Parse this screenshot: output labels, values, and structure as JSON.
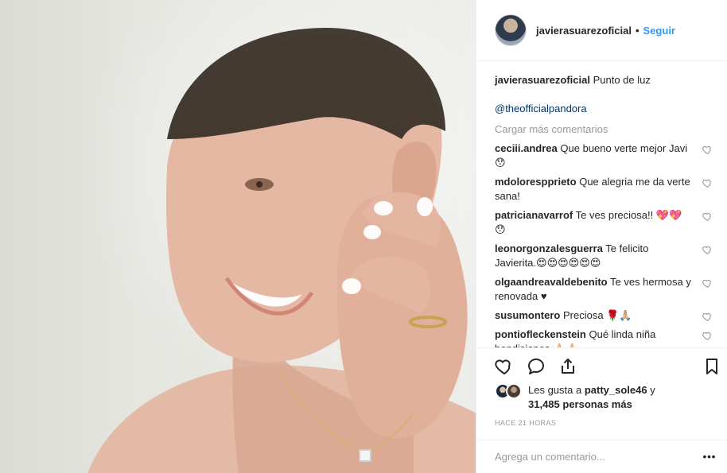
{
  "post": {
    "username": "javierasuarezoficial",
    "follow_label": "Seguir",
    "separator": "•"
  },
  "caption": {
    "username": "javierasuarezoficial",
    "text": "Punto de luz",
    "mention": "@theofficialpandora"
  },
  "load_more_label": "Cargar más comentarios",
  "comments": [
    {
      "username": "ceciii.andrea",
      "text": "Que bueno verte mejor Javi😯"
    },
    {
      "username": "mdolorespprieto",
      "text": "Que alegria me da verte sana!"
    },
    {
      "username": "patricianavarrof",
      "text": "Te ves preciosa!! 💖💖 😯"
    },
    {
      "username": "leonorgonzalesguerra",
      "text": "Te felicito Javierita.😍😍😍😍😍😍"
    },
    {
      "username": "olgaandreavaldebenito",
      "text": "Te ves hermosa y renovada ♥"
    },
    {
      "username": "susumontero",
      "text": "Preciosa 🌹🙏🏼"
    },
    {
      "username": "pontiofleckenstein",
      "text": "Qué linda niña bendiciones 🙏🏻🙏🏻"
    }
  ],
  "likes": {
    "prefix": "Les gusta a",
    "user": "patty_sole46",
    "suffix": "y",
    "count_text": "31,485 personas más"
  },
  "time_ago": "HACE 21 HORAS",
  "add_comment_placeholder": "Agrega un comentario...",
  "more_label": "•••",
  "icons": {
    "like": "heart-icon",
    "comment": "comment-bubble-icon",
    "share": "share-icon",
    "save": "bookmark-icon",
    "comment_like": "heart-icon",
    "more": "ellipsis-icon"
  },
  "colors": {
    "follow": "#3897f0",
    "mention": "#003569",
    "muted": "#999999",
    "text": "#262626"
  }
}
